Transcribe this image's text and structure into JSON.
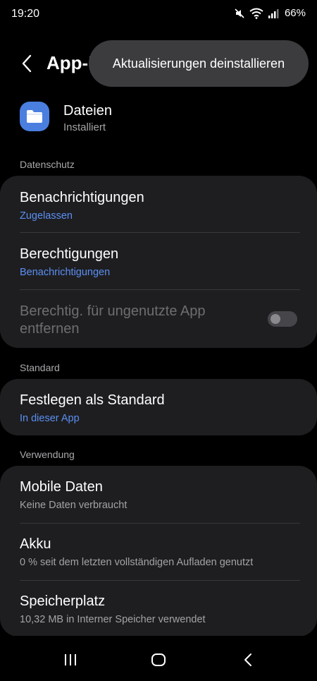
{
  "status_bar": {
    "time": "19:20",
    "battery": "66%",
    "icons": [
      "mute-icon",
      "wifi-icon",
      "signal-icon"
    ]
  },
  "header": {
    "title": "App-Informationen"
  },
  "popup_menu": {
    "items": [
      {
        "label": "Aktualisierungen deinstallieren"
      }
    ]
  },
  "app": {
    "name": "Dateien",
    "status": "Installiert",
    "icon": "folder-icon",
    "icon_color": "#4a7fe0"
  },
  "sections": {
    "privacy": {
      "label": "Datenschutz",
      "rows": [
        {
          "title": "Benachrichtigungen",
          "subtitle": "Zugelassen"
        },
        {
          "title": "Berechtigungen",
          "subtitle": "Benachrichtigungen"
        },
        {
          "title": "Berechtig. für ungenutzte App entfernen",
          "toggle_on": false
        }
      ]
    },
    "default": {
      "label": "Standard",
      "rows": [
        {
          "title": "Festlegen als Standard",
          "subtitle": "In dieser App"
        }
      ]
    },
    "usage": {
      "label": "Verwendung",
      "rows": [
        {
          "title": "Mobile Daten",
          "subtitle": "Keine Daten verbraucht"
        },
        {
          "title": "Akku",
          "subtitle": "0 % seit dem letzten vollständigen Aufladen genutzt"
        },
        {
          "title": "Speicherplatz",
          "subtitle": "10,32 MB in Interner Speicher verwendet"
        }
      ]
    }
  },
  "colors": {
    "background": "#000000",
    "card": "#1e1e21",
    "accent": "#5b8ff2",
    "popup": "#3c3c3f"
  },
  "nav_bar": {
    "buttons": [
      "recents-icon",
      "home-icon",
      "back-icon"
    ]
  }
}
